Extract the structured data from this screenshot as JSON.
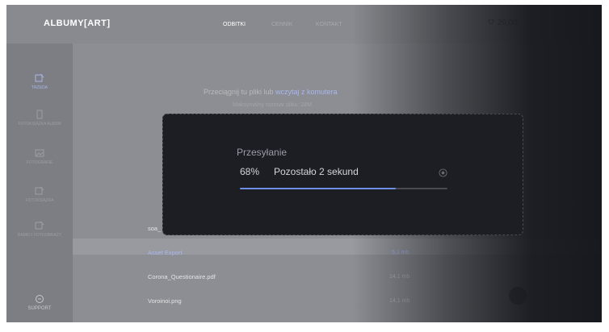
{
  "header": {
    "logo": "ALBUMY[ART]",
    "nav": [
      {
        "label": "ODBITKI"
      },
      {
        "label": "CENNIK"
      },
      {
        "label": "KONTAKT"
      }
    ],
    "cart_total": "20,00"
  },
  "sidebar": {
    "items": [
      {
        "label": "TRZEDA",
        "icon": "edit-box-icon"
      },
      {
        "label": "FOTOKSIĄŻKA ALBUM",
        "icon": "book-icon"
      },
      {
        "label": "FOTOGRAFIE",
        "icon": "photo-icon"
      },
      {
        "label": "FOTOKSIĄŻKA",
        "icon": "album-icon"
      },
      {
        "label": "RAMKI I FOTOOBRAZY",
        "icon": "frame-icon"
      }
    ],
    "support_label": "SUPPORT"
  },
  "upload_area": {
    "text": "Przeciągnij tu pliki lub ",
    "link": "wczytaj z komutera",
    "subtext": "Maksymalny rozmiar pliku: 28M"
  },
  "files": [
    {
      "name": "soa_",
      "size": ""
    },
    {
      "name": "Asset Export",
      "size": "5,1 mb"
    },
    {
      "name": "Corona_Questionaire.pdf",
      "size": "14,1 mb"
    },
    {
      "name": "Voroinoi.png",
      "size": "14,1 mb"
    }
  ],
  "upload_modal": {
    "title": "Przesyłanie",
    "percent_text": "68%",
    "remaining_text": "Pozostało 2 sekund",
    "progress": 0.75
  },
  "colors": {
    "accent": "#6f8fe6",
    "modal_bg": "#1d1e24"
  }
}
